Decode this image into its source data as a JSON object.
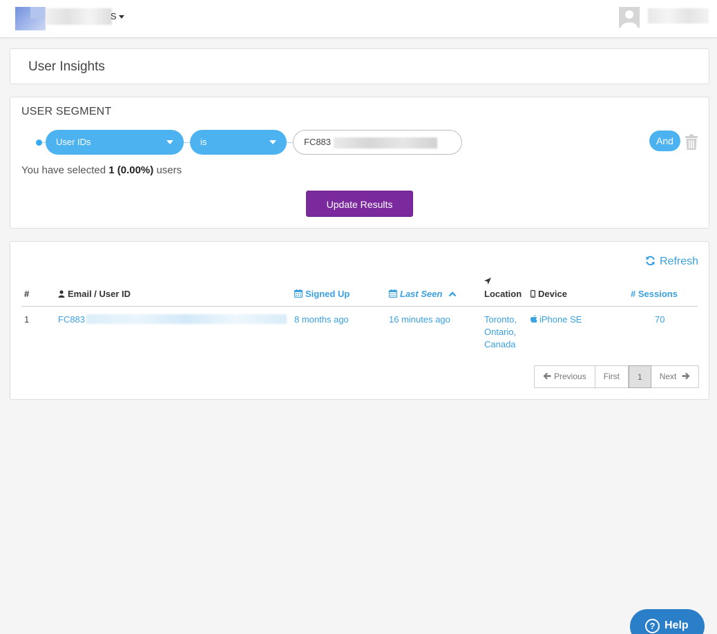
{
  "header": {
    "app_name_suffix": "S",
    "user_name": ""
  },
  "page": {
    "title": "User Insights"
  },
  "segment": {
    "heading": "USER SEGMENT",
    "field_select": "User IDs",
    "operator_select": "is",
    "value_input": "FC883",
    "and_button": "And",
    "selected_prefix": "You have selected",
    "selected_count": "1 (0.00%)",
    "selected_suffix": "users",
    "update_button": "Update Results"
  },
  "results": {
    "refresh_label": "Refresh",
    "columns": {
      "num": "#",
      "email": "Email / User ID",
      "signed_up": "Signed Up",
      "last_seen": "Last Seen",
      "location": "Location",
      "device": "Device",
      "sessions": "# Sessions"
    },
    "rows": [
      {
        "num": "1",
        "user_id": "FC883",
        "signed_up": "8 months ago",
        "last_seen": "16 minutes ago",
        "location_line1": "Toronto,",
        "location_line2": "Ontario,",
        "location_line3": "Canada",
        "device": "iPhone SE",
        "sessions": "70"
      }
    ],
    "pagination": {
      "previous": "Previous",
      "first": "First",
      "current": "1",
      "next": "Next"
    }
  },
  "help": {
    "label": "Help"
  },
  "colors": {
    "accent_blue": "#4db3f0",
    "link_blue": "#3aa0e0",
    "update_purple": "#7b2a9e",
    "help_blue": "#2b7fc9"
  },
  "icons": [
    "user-avatar-icon",
    "user-icon",
    "calendar-icon",
    "chevron-up-icon",
    "location-arrow-icon",
    "mobile-icon",
    "apple-icon",
    "refresh-icon",
    "trash-icon",
    "arrow-left-icon",
    "arrow-right-icon",
    "question-icon"
  ]
}
